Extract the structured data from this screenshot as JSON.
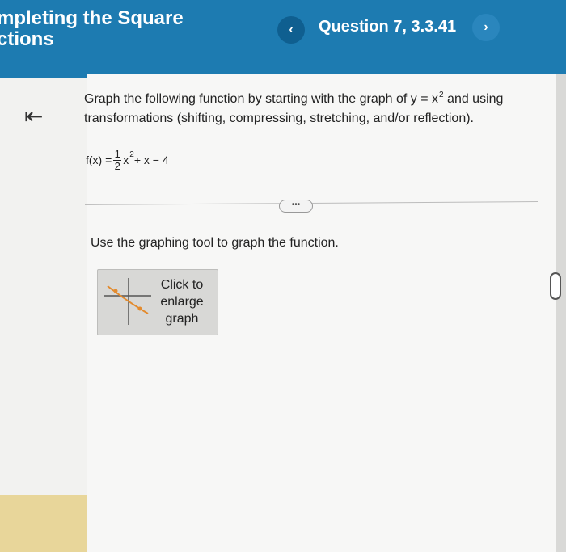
{
  "header": {
    "title_line1": "mpleting the Square",
    "title_line2": "ctions",
    "prev_icon": "‹",
    "next_icon": "›",
    "question_label": "Question 7, 3.3.41"
  },
  "sidebar": {
    "collapse_icon": "⇤"
  },
  "problem": {
    "prompt_before": "Graph the following function by starting with the graph of y = x",
    "prompt_exp": "2",
    "prompt_after": " and using transformations (shifting, compressing, stretching, and/or reflection).",
    "func_prefix": "f(x) =",
    "frac_num": "1",
    "frac_den": "2",
    "func_var": "x",
    "func_exp": "2",
    "func_suffix": " + x − 4",
    "more_label": "•••",
    "instruction": "Use the graphing tool to graph the function.",
    "graph_button_label": [
      "Click to",
      "enlarge",
      "graph"
    ]
  },
  "colors": {
    "header": "#1d7bb1",
    "sidebar_bottom": "#e8d69a",
    "thumb_curve": "#e38b2e"
  }
}
